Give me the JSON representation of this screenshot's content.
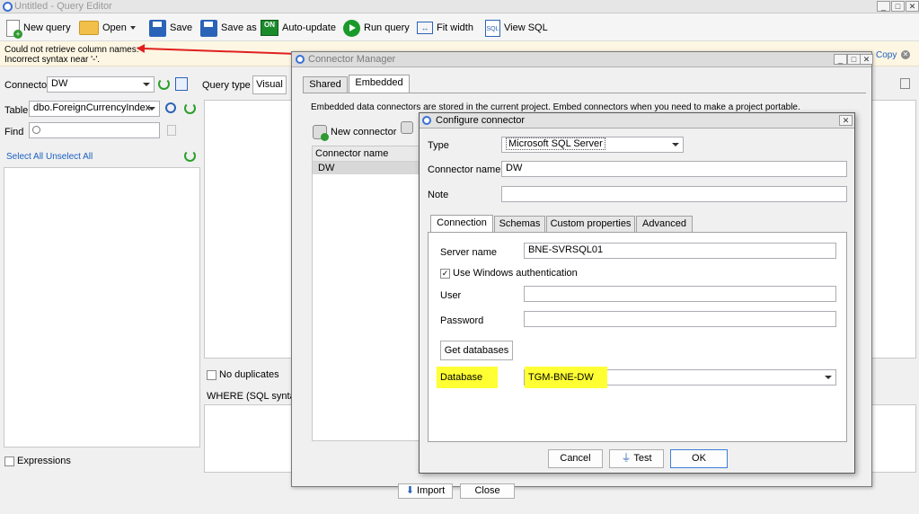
{
  "main_window": {
    "title": "Untitled - Query Editor",
    "controls": [
      "_",
      "□",
      "✕"
    ]
  },
  "toolbar": {
    "new_query": "New query",
    "open": "Open",
    "save": "Save",
    "save_as": "Save as",
    "auto_update_icon_text": "ON",
    "auto_update": "Auto-update",
    "run_query": "Run query",
    "fit_width": "Fit width",
    "sql_icon_text": "SQL",
    "view_sql": "View SQL"
  },
  "error": {
    "line1": "Could not retrieve column names:",
    "line2": "Incorrect syntax near '-'.",
    "copy": "Copy"
  },
  "left_panel": {
    "connector_label": "Connector",
    "connector_value": "DW",
    "query_type_label": "Query type",
    "query_type_value": "Visual",
    "table_label": "Table",
    "table_value": "dbo.ForeignCurrencyIndex",
    "find_label": "Find",
    "find_value": "",
    "select_all": "Select All",
    "unselect_all": "Unselect All",
    "expressions": "Expressions",
    "no_duplicates": "No duplicates",
    "where_label": "WHERE (SQL syntax, p"
  },
  "connector_manager": {
    "title": "Connector Manager",
    "controls": [
      "_",
      "□",
      "✕"
    ],
    "tabs": [
      {
        "label": "Shared"
      },
      {
        "label": "Embedded"
      }
    ],
    "description": "Embedded data connectors are stored in the current project. Embed connectors when you need to make a project portable.",
    "new_connector": "New connector",
    "list_header": "Connector name",
    "list_items": [
      "DW"
    ],
    "import": "Import",
    "close": "Close"
  },
  "configure_connector": {
    "title": "Configure connector",
    "close": "✕",
    "type_label": "Type",
    "type_value": "Microsoft SQL Server",
    "connector_name_label": "Connector name",
    "connector_name_value": "DW",
    "note_label": "Note",
    "note_value": "",
    "tabs": [
      {
        "label": "Connection"
      },
      {
        "label": "Schemas"
      },
      {
        "label": "Custom properties"
      },
      {
        "label": "Advanced"
      }
    ],
    "server_name_label": "Server name",
    "server_name_value": "BNE-SVRSQL01",
    "windows_auth_label": "Use Windows authentication",
    "windows_auth_mark": "✓",
    "user_label": "User",
    "user_value": "",
    "password_label": "Password",
    "password_value": "",
    "get_databases": "Get databases",
    "database_label": "Database",
    "database_value": "TGM-BNE-DW",
    "cancel": "Cancel",
    "test": "Test",
    "ok": "OK"
  },
  "colors": {
    "highlight": "#ffff33",
    "error_arrow": "#e02020",
    "link": "#1a5fc4"
  }
}
